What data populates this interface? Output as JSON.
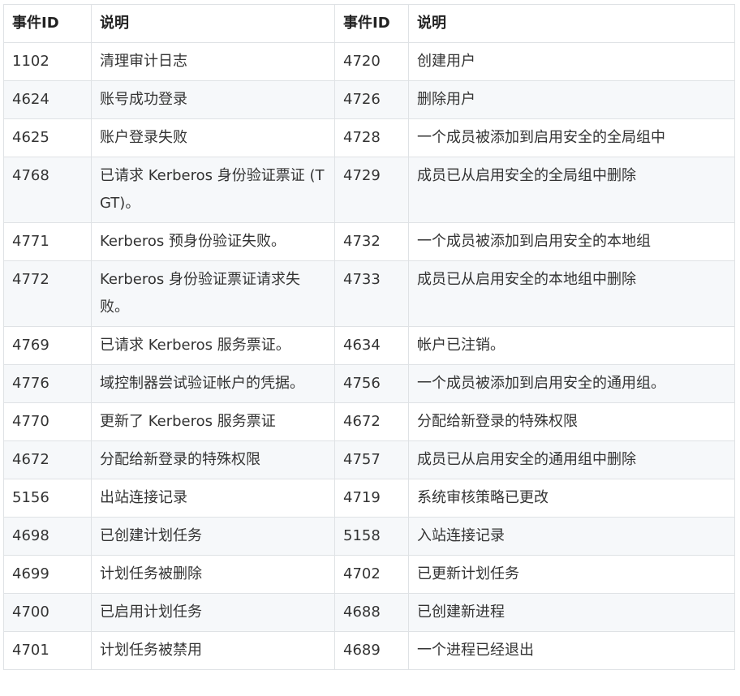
{
  "table": {
    "headers": [
      "事件ID",
      "说明",
      "事件ID",
      "说明"
    ],
    "rows": [
      [
        "1102",
        "清理审计日志",
        "4720",
        "创建用户"
      ],
      [
        "4624",
        "账号成功登录",
        "4726",
        "删除用户"
      ],
      [
        "4625",
        "账户登录失败",
        "4728",
        "一个成员被添加到启用安全的全局组中"
      ],
      [
        "4768",
        "已请求 Kerberos 身份验证票证 (TGT)。",
        "4729",
        "成员已从启用安全的全局组中删除"
      ],
      [
        "4771",
        "Kerberos 预身份验证失败。",
        "4732",
        "一个成员被添加到启用安全的本地组"
      ],
      [
        "4772",
        "Kerberos 身份验证票证请求失败。",
        "4733",
        "成员已从启用安全的本地组中删除"
      ],
      [
        "4769",
        "已请求 Kerberos 服务票证。",
        "4634",
        "帐户已注销。"
      ],
      [
        "4776",
        "域控制器尝试验证帐户的凭据。",
        "4756",
        "一个成员被添加到启用安全的通用组。"
      ],
      [
        "4770",
        "更新了 Kerberos 服务票证",
        "4672",
        "分配给新登录的特殊权限"
      ],
      [
        "4672",
        "分配给新登录的特殊权限",
        "4757",
        "成员已从启用安全的通用组中删除"
      ],
      [
        "5156",
        "出站连接记录",
        "4719",
        "系统审核策略已更改"
      ],
      [
        "4698",
        "已创建计划任务",
        "5158",
        "入站连接记录"
      ],
      [
        "4699",
        "计划任务被删除",
        "4702",
        "已更新计划任务"
      ],
      [
        "4700",
        "已启用计划任务",
        "4688",
        "已创建新进程"
      ],
      [
        "4701",
        "计划任务被禁用",
        "4689",
        "一个进程已经退出"
      ]
    ]
  },
  "colors": {
    "border": "#dfe2e5",
    "stripe": "#f6f8fa",
    "text": "#333333"
  }
}
